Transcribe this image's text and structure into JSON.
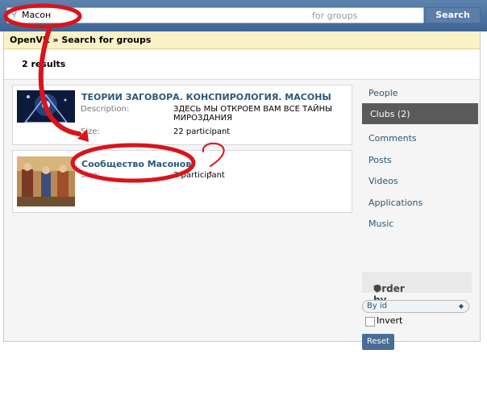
{
  "header": {
    "search_value": "Масон",
    "search_placeholder": "for groups",
    "search_button": "Search"
  },
  "breadcrumb": "OpenVK » Search for groups",
  "results_count": "2 results",
  "results": [
    {
      "title": "ТЕОРИИ ЗАГОВОРА. КОНСПИРОЛОГИЯ. МАСОНЫ",
      "description_label": "Description:",
      "description": "ЗДЕСЬ МЫ ОТКРОЕМ ВАМ ВСЕ ТАЙНЫ МИРОЗДАНИЯ",
      "size_label": "Size:",
      "size": "22 participant"
    },
    {
      "title": "Сообщество Масонов",
      "size_label": "Size:",
      "size": "2 participant"
    }
  ],
  "sidebar": {
    "items": [
      "People",
      "Clubs (2)",
      "Comments",
      "Posts",
      "Videos",
      "Applications",
      "Music"
    ],
    "active_index": 1,
    "order_title": "Order by...",
    "order_value": "By id",
    "invert_label": "Invert",
    "reset_label": "Reset"
  },
  "colors": {
    "topbar": "#4a6d95",
    "link": "#2b587a",
    "annotation": "#d9141b"
  }
}
